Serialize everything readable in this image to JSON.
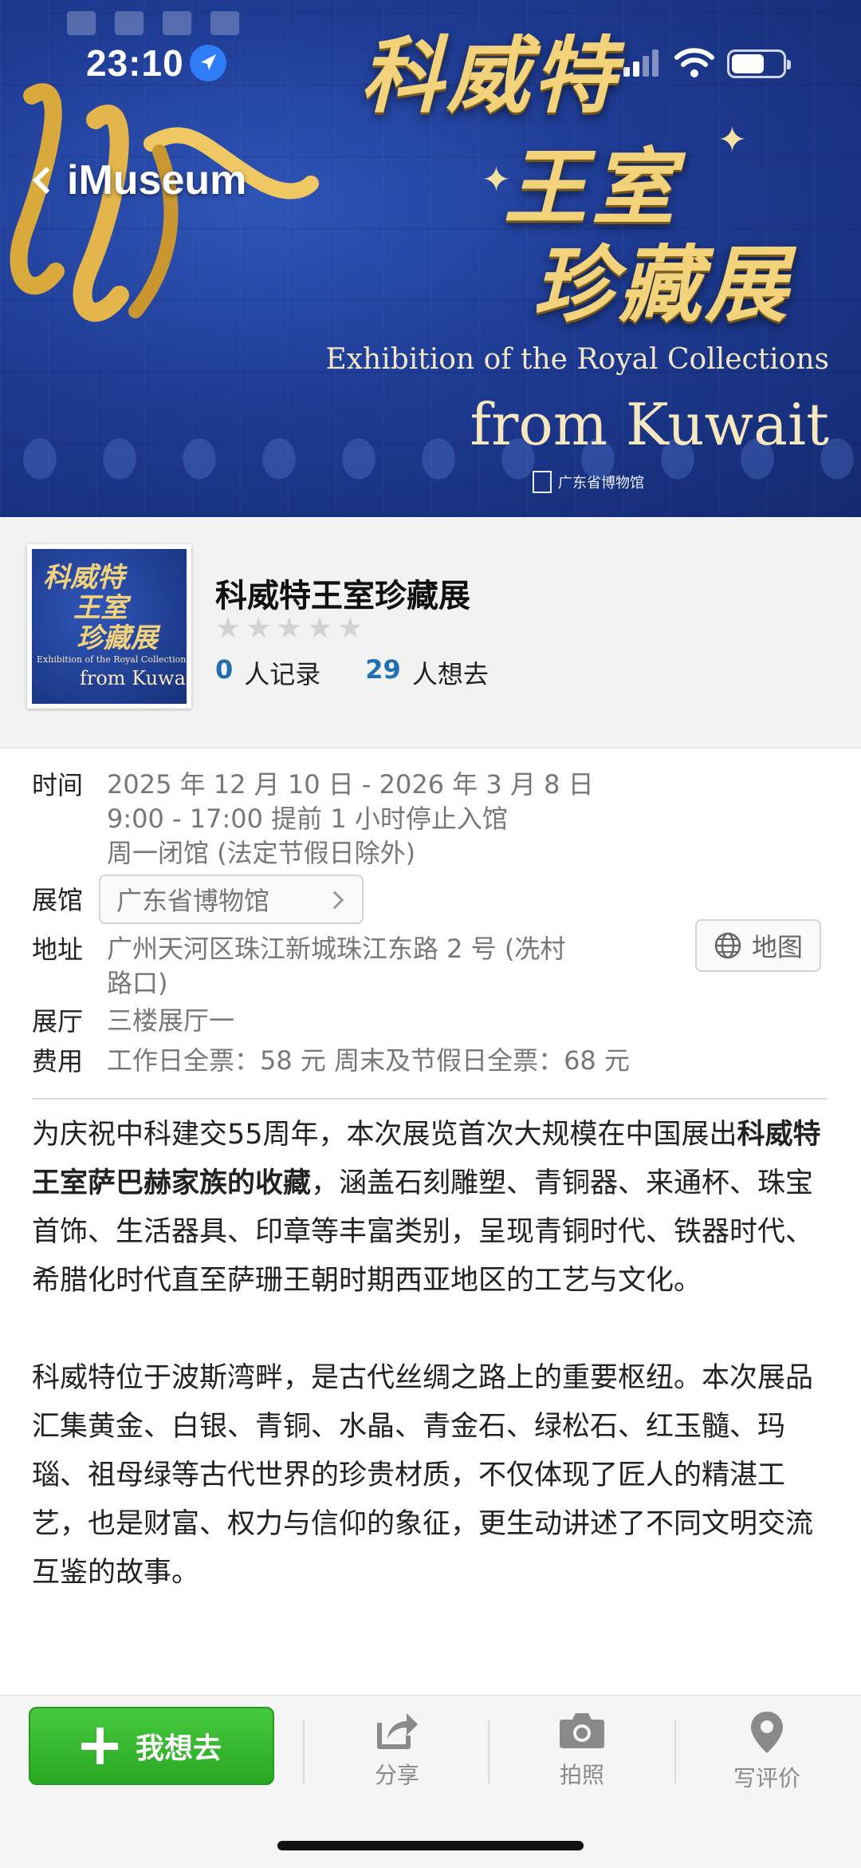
{
  "status_bar": {
    "time": "23:10"
  },
  "nav": {
    "back_label": "iMuseum"
  },
  "hero": {
    "title_line1": "科威特",
    "title_line2": "王室",
    "title_line3": "珍藏展",
    "subtitle_en_1": "Exhibition of the Royal Collections",
    "subtitle_en_2": "from Kuwait",
    "museum_mark": "广东省博物馆"
  },
  "exhibit": {
    "name": "科威特王室珍藏展",
    "rating": 0,
    "recorded_count": "0",
    "recorded_label": "人记录",
    "want_count": "29",
    "want_label": "人想去"
  },
  "details": {
    "time_label": "时间",
    "time_line1": "2025 年 12 月 10 日 - 2026 年 3 月 8 日",
    "time_line2": "9:00 - 17:00  提前 1 小时停止入馆",
    "time_line3": "周一闭馆 (法定节假日除外)",
    "venue_label": "展馆",
    "venue_value": "广东省博物馆",
    "address_label": "地址",
    "address_line1": "广州天河区珠江新城珠江东路 2 号 (冼村",
    "address_line2": "路口)",
    "map_label": "地图",
    "hall_label": "展厅",
    "hall_value": "三楼展厅一",
    "fee_label": "费用",
    "fee_value": "工作日全票：58 元 周末及节假日全票：68 元"
  },
  "description": {
    "p1_a": "为庆祝中科建交55周年，本次展览首次大规模在中国展出",
    "p1_bold": "科威特王室萨巴赫家族的收藏",
    "p1_b": "，涵盖石刻雕塑、青铜器、来通杯、珠宝首饰、生活器具、印章等丰富类别，呈现青铜时代、铁器时代、希腊化时代直至萨珊王朝时期西亚地区的工艺与文化。",
    "p2": "科威特位于波斯湾畔，是古代丝绸之路上的重要枢纽。本次展品汇集黄金、白银、青铜、水晶、青金石、绿松石、红玉髓、玛瑙、祖母绿等古代世界的珍贵材质，不仅体现了匠人的精湛工艺，也是财富、权力与信仰的象征，更生动讲述了不同文明交流互鉴的故事。"
  },
  "bottom_bar": {
    "want_button": "我想去",
    "share": "分享",
    "photo": "拍照",
    "review": "写评价"
  },
  "colors": {
    "accent_green": "#2aa823",
    "count_blue": "#1f6fb2",
    "hero_blue": "#1e3b93",
    "gold": "#f2d27a"
  }
}
